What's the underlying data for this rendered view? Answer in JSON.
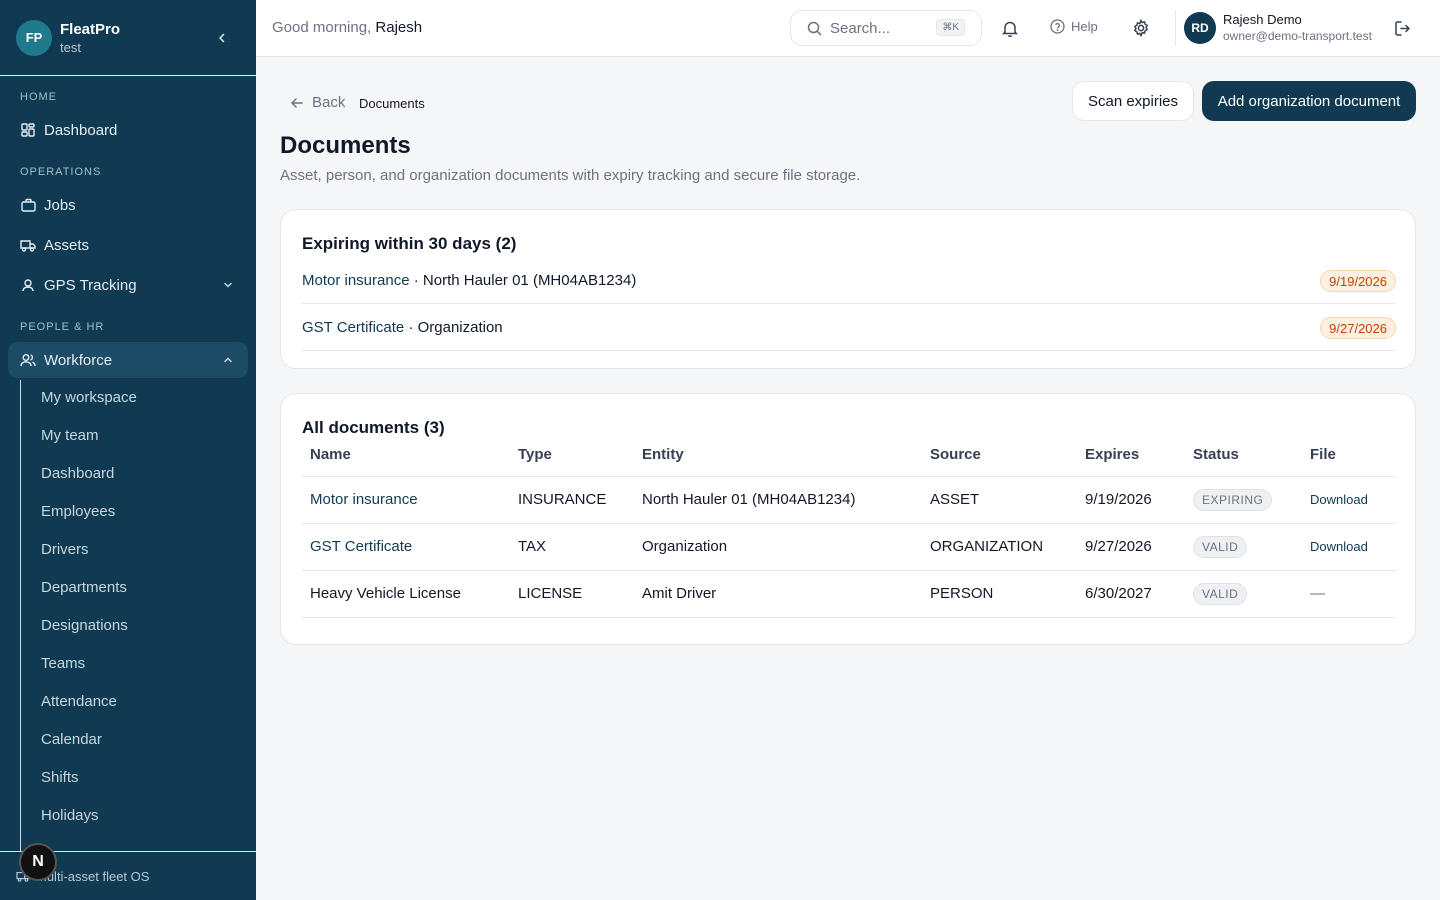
{
  "sidebar": {
    "brand_initials": "FP",
    "brand_name": "FleatPro",
    "brand_sub": "test",
    "sections": {
      "home": "HOME",
      "operations": "OPERATIONS",
      "people": "PEOPLE & HR"
    },
    "items": {
      "dashboard": "Dashboard",
      "jobs": "Jobs",
      "assets": "Assets",
      "gps": "GPS Tracking",
      "workforce": "Workforce"
    },
    "sub_items": [
      "My workspace",
      "My team",
      "Dashboard",
      "Employees",
      "Drivers",
      "Departments",
      "Designations",
      "Teams",
      "Attendance",
      "Calendar",
      "Shifts",
      "Holidays"
    ],
    "footer": "Multi-asset fleet OS",
    "n_badge": "N"
  },
  "topbar": {
    "greeting": "Good morning,",
    "greeting_name": "Rajesh",
    "search_placeholder": "Search...",
    "search_shortcut": "⌘K",
    "help": "Help",
    "user_initials": "RD",
    "user_name": "Rajesh Demo",
    "user_email": "owner@demo-transport.test"
  },
  "header": {
    "back": "Back",
    "breadcrumb": "Documents",
    "scan_button": "Scan expiries",
    "add_button": "Add organization document",
    "title": "Documents",
    "subtitle": "Asset, person, and organization documents with expiry tracking and secure file storage."
  },
  "expiring": {
    "title": "Expiring within 30 days (2)",
    "rows": [
      {
        "name": "Motor insurance",
        "entity": " · North Hauler 01 (MH04AB1234)",
        "date": "9/19/2026"
      },
      {
        "name": "GST Certificate",
        "entity": " · Organization",
        "date": "9/27/2026"
      }
    ]
  },
  "all_documents": {
    "title": "All documents (3)",
    "columns": [
      "Name",
      "Type",
      "Entity",
      "Source",
      "Expires",
      "Status",
      "File"
    ],
    "rows": [
      {
        "name": "Motor insurance",
        "type": "INSURANCE",
        "entity": "North Hauler 01 (MH04AB1234)",
        "source": "ASSET",
        "expires": "9/19/2026",
        "status": "EXPIRING",
        "file": "Download"
      },
      {
        "name": "GST Certificate",
        "type": "TAX",
        "entity": "Organization",
        "source": "ORGANIZATION",
        "expires": "9/27/2026",
        "status": "VALID",
        "file": "Download"
      },
      {
        "name": "Heavy Vehicle License",
        "type": "LICENSE",
        "entity": "Amit Driver",
        "source": "PERSON",
        "expires": "6/30/2027",
        "status": "VALID",
        "file": "—"
      }
    ]
  },
  "colors": {
    "sidebar_bg": "#0f3a52",
    "primary": "#0f3a52",
    "expiring_pill": "#c2410c"
  }
}
